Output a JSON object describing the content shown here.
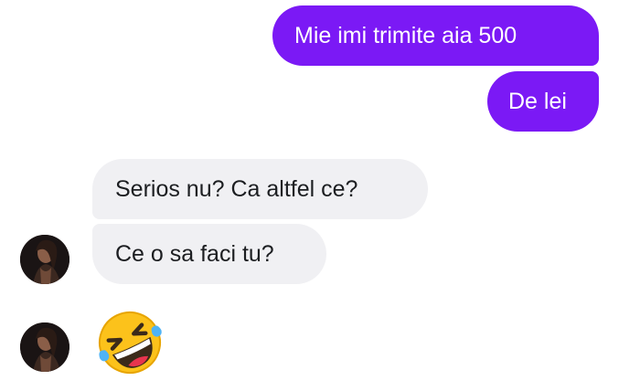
{
  "conversation": {
    "messages": [
      {
        "sender": "me",
        "text": "Mie imi trimite aia 500"
      },
      {
        "sender": "me",
        "text": "De lei"
      },
      {
        "sender": "contact",
        "text": "Serios nu? Ca altfel ce?"
      },
      {
        "sender": "contact",
        "text": "Ce o sa faci tu?"
      }
    ],
    "reaction_emoji": "rolling-on-floor-laughing-emoji"
  },
  "colors": {
    "outgoing_bubble": "#7b19f5",
    "incoming_bubble": "#f0f0f3",
    "background": "#ffffff"
  },
  "icons": {
    "avatar": "contact-avatar-photo",
    "emoji": "rolling-on-floor-laughing-emoji"
  }
}
